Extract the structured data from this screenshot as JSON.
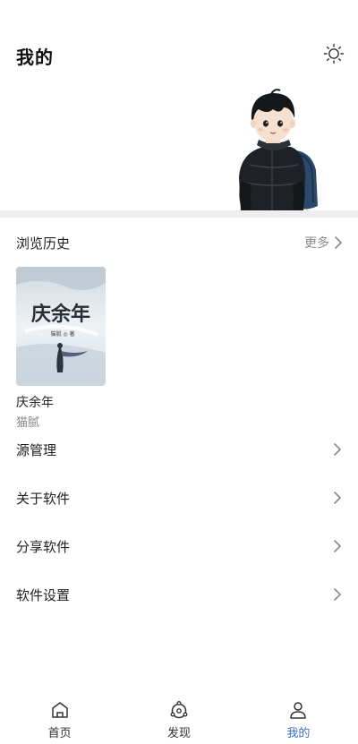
{
  "header": {
    "title": "我的",
    "theme_icon": "sun-icon",
    "mascot": "boy-with-backpack-illustration"
  },
  "history": {
    "title": "浏览历史",
    "more_label": "更多",
    "books": [
      {
        "name": "庆余年",
        "author": "猫腻",
        "cover_title": "庆余年",
        "cover_byline": "猫腻 ◎ 著"
      }
    ]
  },
  "menu": {
    "items": [
      {
        "label": "源管理",
        "icon": "chevron-right-icon"
      },
      {
        "label": "关于软件",
        "icon": "chevron-right-icon"
      },
      {
        "label": "分享软件",
        "icon": "chevron-right-icon"
      },
      {
        "label": "软件设置",
        "icon": "chevron-right-icon"
      }
    ]
  },
  "tabbar": {
    "tabs": [
      {
        "label": "首页",
        "icon": "home-icon",
        "active": false
      },
      {
        "label": "发现",
        "icon": "discover-icon",
        "active": false
      },
      {
        "label": "我的",
        "icon": "user-icon",
        "active": true
      }
    ],
    "active_color": "#3b6fd6"
  }
}
